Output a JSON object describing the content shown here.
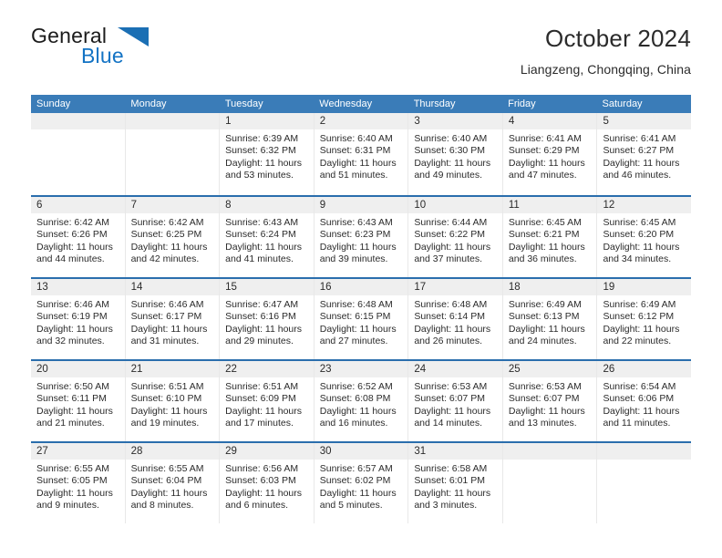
{
  "logo": {
    "word_one": "General",
    "word_two": "Blue",
    "triangle_icon": "triangle-icon",
    "accent_color": "#1373c4"
  },
  "header": {
    "title": "October 2024",
    "location": "Liangzeng, Chongqing, China"
  },
  "theme": {
    "header_blue": "#3a7cb8",
    "row_divider_blue": "#2a6ead",
    "day_band_gray": "#efefef"
  },
  "weekdays": [
    "Sunday",
    "Monday",
    "Tuesday",
    "Wednesday",
    "Thursday",
    "Friday",
    "Saturday"
  ],
  "weeks": [
    [
      {
        "day": "",
        "sunrise": "",
        "sunset": "",
        "daylight_line1": "",
        "daylight_line2": ""
      },
      {
        "day": "",
        "sunrise": "",
        "sunset": "",
        "daylight_line1": "",
        "daylight_line2": ""
      },
      {
        "day": "1",
        "sunrise": "Sunrise: 6:39 AM",
        "sunset": "Sunset: 6:32 PM",
        "daylight_line1": "Daylight: 11 hours",
        "daylight_line2": "and 53 minutes."
      },
      {
        "day": "2",
        "sunrise": "Sunrise: 6:40 AM",
        "sunset": "Sunset: 6:31 PM",
        "daylight_line1": "Daylight: 11 hours",
        "daylight_line2": "and 51 minutes."
      },
      {
        "day": "3",
        "sunrise": "Sunrise: 6:40 AM",
        "sunset": "Sunset: 6:30 PM",
        "daylight_line1": "Daylight: 11 hours",
        "daylight_line2": "and 49 minutes."
      },
      {
        "day": "4",
        "sunrise": "Sunrise: 6:41 AM",
        "sunset": "Sunset: 6:29 PM",
        "daylight_line1": "Daylight: 11 hours",
        "daylight_line2": "and 47 minutes."
      },
      {
        "day": "5",
        "sunrise": "Sunrise: 6:41 AM",
        "sunset": "Sunset: 6:27 PM",
        "daylight_line1": "Daylight: 11 hours",
        "daylight_line2": "and 46 minutes."
      }
    ],
    [
      {
        "day": "6",
        "sunrise": "Sunrise: 6:42 AM",
        "sunset": "Sunset: 6:26 PM",
        "daylight_line1": "Daylight: 11 hours",
        "daylight_line2": "and 44 minutes."
      },
      {
        "day": "7",
        "sunrise": "Sunrise: 6:42 AM",
        "sunset": "Sunset: 6:25 PM",
        "daylight_line1": "Daylight: 11 hours",
        "daylight_line2": "and 42 minutes."
      },
      {
        "day": "8",
        "sunrise": "Sunrise: 6:43 AM",
        "sunset": "Sunset: 6:24 PM",
        "daylight_line1": "Daylight: 11 hours",
        "daylight_line2": "and 41 minutes."
      },
      {
        "day": "9",
        "sunrise": "Sunrise: 6:43 AM",
        "sunset": "Sunset: 6:23 PM",
        "daylight_line1": "Daylight: 11 hours",
        "daylight_line2": "and 39 minutes."
      },
      {
        "day": "10",
        "sunrise": "Sunrise: 6:44 AM",
        "sunset": "Sunset: 6:22 PM",
        "daylight_line1": "Daylight: 11 hours",
        "daylight_line2": "and 37 minutes."
      },
      {
        "day": "11",
        "sunrise": "Sunrise: 6:45 AM",
        "sunset": "Sunset: 6:21 PM",
        "daylight_line1": "Daylight: 11 hours",
        "daylight_line2": "and 36 minutes."
      },
      {
        "day": "12",
        "sunrise": "Sunrise: 6:45 AM",
        "sunset": "Sunset: 6:20 PM",
        "daylight_line1": "Daylight: 11 hours",
        "daylight_line2": "and 34 minutes."
      }
    ],
    [
      {
        "day": "13",
        "sunrise": "Sunrise: 6:46 AM",
        "sunset": "Sunset: 6:19 PM",
        "daylight_line1": "Daylight: 11 hours",
        "daylight_line2": "and 32 minutes."
      },
      {
        "day": "14",
        "sunrise": "Sunrise: 6:46 AM",
        "sunset": "Sunset: 6:17 PM",
        "daylight_line1": "Daylight: 11 hours",
        "daylight_line2": "and 31 minutes."
      },
      {
        "day": "15",
        "sunrise": "Sunrise: 6:47 AM",
        "sunset": "Sunset: 6:16 PM",
        "daylight_line1": "Daylight: 11 hours",
        "daylight_line2": "and 29 minutes."
      },
      {
        "day": "16",
        "sunrise": "Sunrise: 6:48 AM",
        "sunset": "Sunset: 6:15 PM",
        "daylight_line1": "Daylight: 11 hours",
        "daylight_line2": "and 27 minutes."
      },
      {
        "day": "17",
        "sunrise": "Sunrise: 6:48 AM",
        "sunset": "Sunset: 6:14 PM",
        "daylight_line1": "Daylight: 11 hours",
        "daylight_line2": "and 26 minutes."
      },
      {
        "day": "18",
        "sunrise": "Sunrise: 6:49 AM",
        "sunset": "Sunset: 6:13 PM",
        "daylight_line1": "Daylight: 11 hours",
        "daylight_line2": "and 24 minutes."
      },
      {
        "day": "19",
        "sunrise": "Sunrise: 6:49 AM",
        "sunset": "Sunset: 6:12 PM",
        "daylight_line1": "Daylight: 11 hours",
        "daylight_line2": "and 22 minutes."
      }
    ],
    [
      {
        "day": "20",
        "sunrise": "Sunrise: 6:50 AM",
        "sunset": "Sunset: 6:11 PM",
        "daylight_line1": "Daylight: 11 hours",
        "daylight_line2": "and 21 minutes."
      },
      {
        "day": "21",
        "sunrise": "Sunrise: 6:51 AM",
        "sunset": "Sunset: 6:10 PM",
        "daylight_line1": "Daylight: 11 hours",
        "daylight_line2": "and 19 minutes."
      },
      {
        "day": "22",
        "sunrise": "Sunrise: 6:51 AM",
        "sunset": "Sunset: 6:09 PM",
        "daylight_line1": "Daylight: 11 hours",
        "daylight_line2": "and 17 minutes."
      },
      {
        "day": "23",
        "sunrise": "Sunrise: 6:52 AM",
        "sunset": "Sunset: 6:08 PM",
        "daylight_line1": "Daylight: 11 hours",
        "daylight_line2": "and 16 minutes."
      },
      {
        "day": "24",
        "sunrise": "Sunrise: 6:53 AM",
        "sunset": "Sunset: 6:07 PM",
        "daylight_line1": "Daylight: 11 hours",
        "daylight_line2": "and 14 minutes."
      },
      {
        "day": "25",
        "sunrise": "Sunrise: 6:53 AM",
        "sunset": "Sunset: 6:07 PM",
        "daylight_line1": "Daylight: 11 hours",
        "daylight_line2": "and 13 minutes."
      },
      {
        "day": "26",
        "sunrise": "Sunrise: 6:54 AM",
        "sunset": "Sunset: 6:06 PM",
        "daylight_line1": "Daylight: 11 hours",
        "daylight_line2": "and 11 minutes."
      }
    ],
    [
      {
        "day": "27",
        "sunrise": "Sunrise: 6:55 AM",
        "sunset": "Sunset: 6:05 PM",
        "daylight_line1": "Daylight: 11 hours",
        "daylight_line2": "and 9 minutes."
      },
      {
        "day": "28",
        "sunrise": "Sunrise: 6:55 AM",
        "sunset": "Sunset: 6:04 PM",
        "daylight_line1": "Daylight: 11 hours",
        "daylight_line2": "and 8 minutes."
      },
      {
        "day": "29",
        "sunrise": "Sunrise: 6:56 AM",
        "sunset": "Sunset: 6:03 PM",
        "daylight_line1": "Daylight: 11 hours",
        "daylight_line2": "and 6 minutes."
      },
      {
        "day": "30",
        "sunrise": "Sunrise: 6:57 AM",
        "sunset": "Sunset: 6:02 PM",
        "daylight_line1": "Daylight: 11 hours",
        "daylight_line2": "and 5 minutes."
      },
      {
        "day": "31",
        "sunrise": "Sunrise: 6:58 AM",
        "sunset": "Sunset: 6:01 PM",
        "daylight_line1": "Daylight: 11 hours",
        "daylight_line2": "and 3 minutes."
      },
      {
        "day": "",
        "sunrise": "",
        "sunset": "",
        "daylight_line1": "",
        "daylight_line2": ""
      },
      {
        "day": "",
        "sunrise": "",
        "sunset": "",
        "daylight_line1": "",
        "daylight_line2": ""
      }
    ]
  ]
}
